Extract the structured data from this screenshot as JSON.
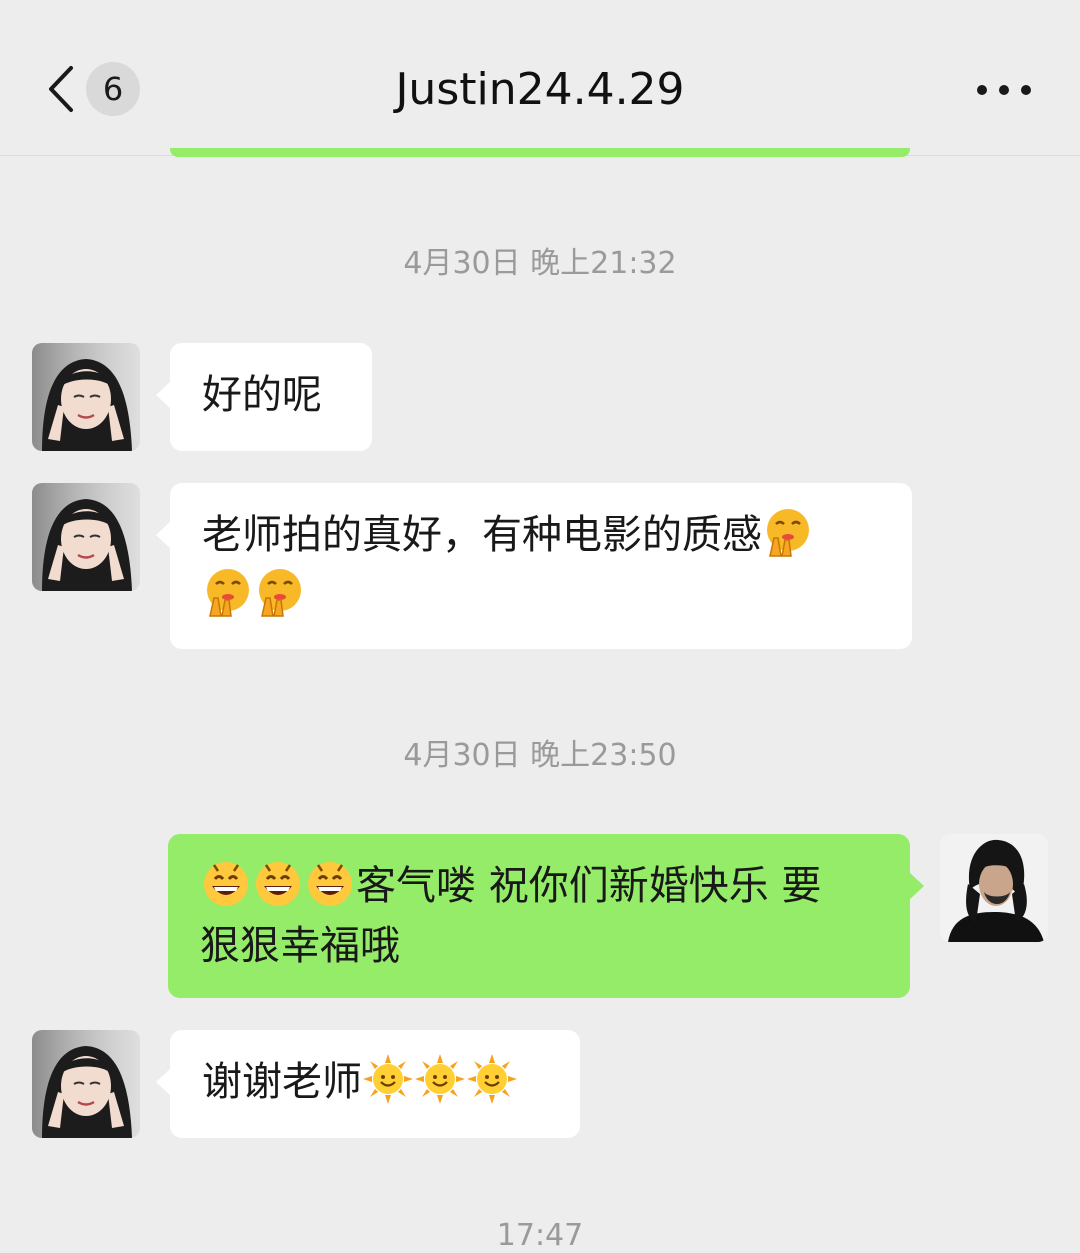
{
  "nav": {
    "unread_count": "6",
    "title": "Justin24.4.29",
    "more_label": "•••"
  },
  "messages": [
    {
      "type": "timestamp",
      "text": "4月30日 晚上21:32"
    },
    {
      "type": "received",
      "text": "好的呢"
    },
    {
      "type": "received",
      "text": "老师拍的真好，有种电影的质感",
      "trailing_emoji": [
        "face-peeking-icon",
        "face-peeking-icon",
        "face-peeking-icon"
      ]
    },
    {
      "type": "timestamp",
      "text": "4月30日 晚上23:50"
    },
    {
      "type": "sent",
      "leading_emoji": [
        "grinning-face-icon",
        "grinning-face-icon",
        "grinning-face-icon"
      ],
      "text_line1": "客气喽 祝你们新婚快乐 要",
      "text_line2": "狠狠幸福哦"
    },
    {
      "type": "received",
      "text": "谢谢老师",
      "trailing_emoji": [
        "sun-icon",
        "sun-icon",
        "sun-icon"
      ]
    },
    {
      "type": "timestamp",
      "text": "17:47"
    }
  ],
  "colors": {
    "background": "#ededed",
    "sent_bubble": "#95ec69",
    "received_bubble": "#ffffff",
    "timestamp": "#9a9a9a"
  }
}
